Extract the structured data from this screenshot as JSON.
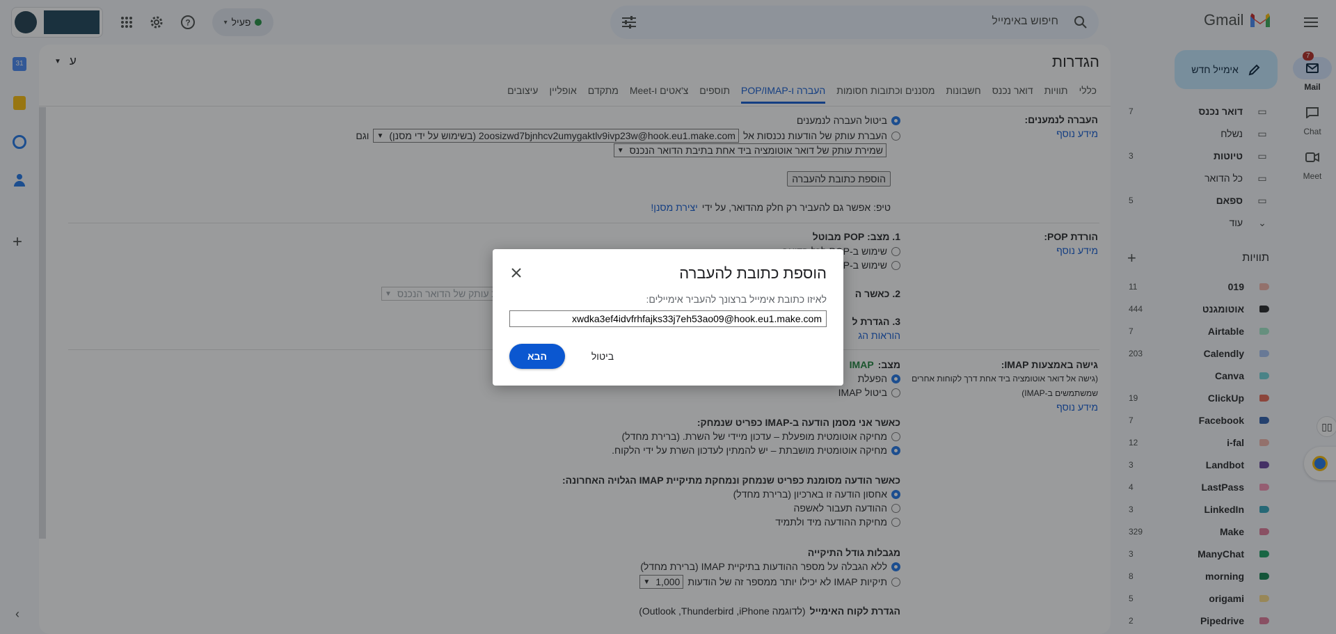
{
  "topbar": {
    "app_name": "Gmail",
    "search_placeholder": "חיפוש באימייל",
    "status": "פעיל",
    "mail_badge": "7"
  },
  "rail": {
    "mail": "Mail",
    "chat": "Chat",
    "meet": "Meet"
  },
  "sidebar": {
    "compose": "אימייל חדש",
    "folders": [
      {
        "name": "דואר נכנס",
        "count": "7",
        "icon": "inbox-icon",
        "bold": true
      },
      {
        "name": "נשלח",
        "count": "",
        "icon": "send-icon",
        "bold": false
      },
      {
        "name": "טיוטות",
        "count": "3",
        "icon": "draft-icon",
        "bold": true
      },
      {
        "name": "כל הדואר",
        "count": "",
        "icon": "all-mail-icon",
        "bold": false
      },
      {
        "name": "ספאם",
        "count": "5",
        "icon": "spam-icon",
        "bold": true
      },
      {
        "name": "עוד",
        "count": "",
        "icon": "chevron-down-icon",
        "bold": false
      }
    ],
    "labels_title": "תוויות",
    "labels": [
      {
        "name": "019",
        "count": "11",
        "color": "#f2b2a8"
      },
      {
        "name": "אוטומגנט",
        "count": "444",
        "color": "#202124"
      },
      {
        "name": "Airtable",
        "count": "7",
        "color": "#a0eac9"
      },
      {
        "name": "Calendly",
        "count": "203",
        "color": "#a4c2f4"
      },
      {
        "name": "Canva",
        "count": "",
        "color": "#6dd3d9"
      },
      {
        "name": "ClickUp",
        "count": "19",
        "color": "#e66550"
      },
      {
        "name": "Facebook",
        "count": "7",
        "color": "#285bac"
      },
      {
        "name": "i-fal",
        "count": "12",
        "color": "#f2b2a8"
      },
      {
        "name": "Landbot",
        "count": "3",
        "color": "#653e9b"
      },
      {
        "name": "LastPass",
        "count": "4",
        "color": "#f691b2"
      },
      {
        "name": "LinkedIn",
        "count": "3",
        "color": "#2da2bb"
      },
      {
        "name": "Make",
        "count": "329",
        "color": "#e07798"
      },
      {
        "name": "ManyChat",
        "count": "3",
        "color": "#149e60"
      },
      {
        "name": "morning",
        "count": "8",
        "color": "#0b804b"
      },
      {
        "name": "origami",
        "count": "5",
        "color": "#fcda83"
      },
      {
        "name": "Pipedrive",
        "count": "2",
        "color": "#e07798"
      }
    ]
  },
  "settings": {
    "title": "הגדרות",
    "lang_label": "ע",
    "tabs": [
      "כללי",
      "תוויות",
      "דואר נכנס",
      "חשבונות",
      "מסננים וכתובות חסומות",
      "העברה ו-POP/IMAP",
      "תוספים",
      "צ'אטים ו-Meet",
      "מתקדם",
      "אופליין",
      "עיצובים"
    ],
    "forwarding": {
      "label": "העברה לנמענים:",
      "learn_more": "מידע נוסף",
      "opt_disable": "ביטול העברה לנמענים",
      "opt_forward": "העברת עותק של הודעות נכנסות אל",
      "forward_address": "2oosizwd7bjnhcv2umygaktlv9ivp23w@hook.eu1.make.com (בשימוש על ידי מסנן)",
      "and": "וגם",
      "keep_copy": "שמירת עותק של דואר אוטומציה ביד אחת בתיבת הדואר הנכנס",
      "add_button": "הוספת כתובת להעברה",
      "tip": "טיפ: אפשר גם להעביר רק חלק מהדואר, על ידי",
      "tip_link": "יצירת מסנן!"
    },
    "pop": {
      "label": "הורדת POP:",
      "learn_more": "מידע נוסף",
      "status": "1. מצב: POP מבוטל",
      "opt1": "שימוש ב-POP לכל הדואר",
      "opt2": "שימוש ב-POP",
      "step2": "2. כאשר ה",
      "step2_select": "שמירת עותק של הדואר הנכנס",
      "step3": "3. הגדרת ל",
      "step3_link": "הוראות הג"
    },
    "imap": {
      "label": "גישה באמצעות IMAP:",
      "desc1": "(גישה אל דואר אוטומציה ביד אחת דרך לקוחות אחרים",
      "desc2": "שמשתמשים ב-IMAP)",
      "learn_more": "מידע נוסף",
      "status_prefix": "מצב:",
      "status_value": "IMAP",
      "opt_enable": "הפעלת",
      "opt_disable": "ביטול IMAP",
      "deleted_title": "כאשר אני מסמן הודעה ב-IMAP כפריט שנמחק:",
      "deleted_opt1": "מחיקה אוטומטית מופעלת – עדכון מיידי של השרת. (ברירת מחדל)",
      "deleted_opt2": "מחיקה אוטומטית מושבתת – יש להמתין לעדכון השרת על ידי הלקוח.",
      "expunge_title": "כאשר הודעה מסומנת כפריט שנמחק ונמחקת מתיקיית IMAP הגלויה האחרונה:",
      "expunge_opt1": "אחסון הודעה זו בארכיון (ברירת מחדל)",
      "expunge_opt2": "ההודעה תעבור לאשפה",
      "expunge_opt3": "מחיקת ההודעה מיד ולתמיד",
      "limits_title": "מגבלות גודל התיקייה",
      "limits_opt1": "ללא הגבלה על מספר ההודעות בתיקיית IMAP (ברירת מחדל)",
      "limits_opt2": "תיקיות IMAP לא יכילו יותר ממספר זה של הודעות",
      "limits_value": "1,000",
      "client_title": "הגדרת לקוח האימייל",
      "client_desc": "(לדוגמה Outlook ,Thunderbird ,iPhone)"
    }
  },
  "dialog": {
    "title": "הוספת כתובת להעברה",
    "prompt": "לאיזו כתובת אימייל ברצונך להעביר אימיילים:",
    "input_value": "xwdka3ef4idvfrhfajks33j7eh53ao09@hook.eu1.make.com",
    "next": "הבא",
    "cancel": "ביטול"
  }
}
